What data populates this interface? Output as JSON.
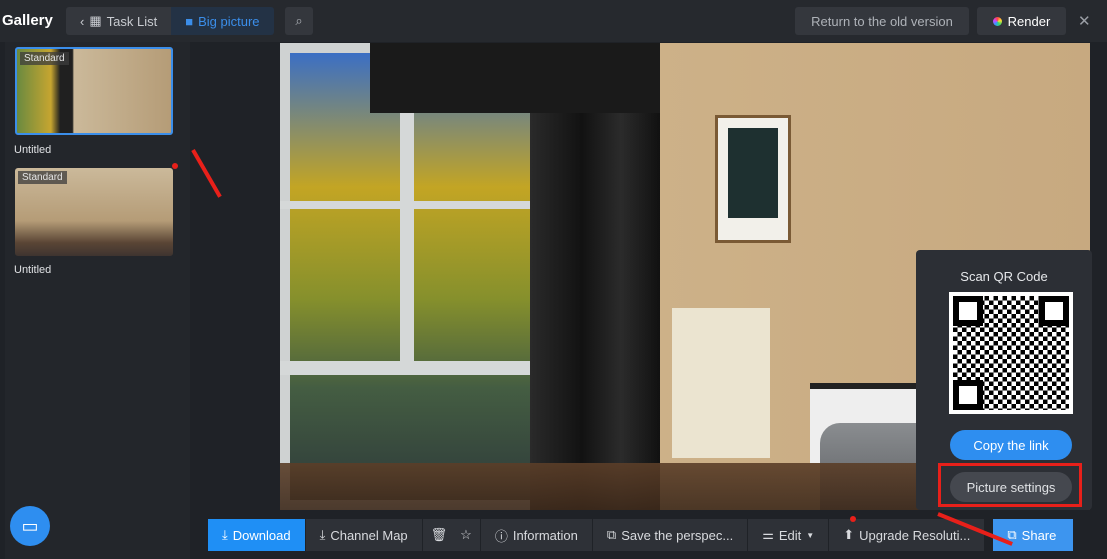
{
  "header": {
    "title": "Gallery",
    "task_list": "Task List",
    "big_picture": "Big picture",
    "return_old": "Return to the old version",
    "render": "Render"
  },
  "sidebar": {
    "items": [
      {
        "tag": "Standard",
        "label": "Untitled",
        "selected": true
      },
      {
        "tag": "Standard",
        "label": "Untitled",
        "selected": false
      }
    ]
  },
  "toolbar": {
    "download": "Download",
    "channel_map": "Channel Map",
    "information": "Information",
    "save_perspective": "Save the perspec...",
    "edit": "Edit",
    "upgrade": "Upgrade Resoluti...",
    "share": "Share"
  },
  "share_popup": {
    "title": "Scan QR Code",
    "copy_link": "Copy the link",
    "picture_settings": "Picture settings"
  },
  "colors": {
    "accent": "#1f8ff5",
    "annotation": "#e8201a"
  }
}
